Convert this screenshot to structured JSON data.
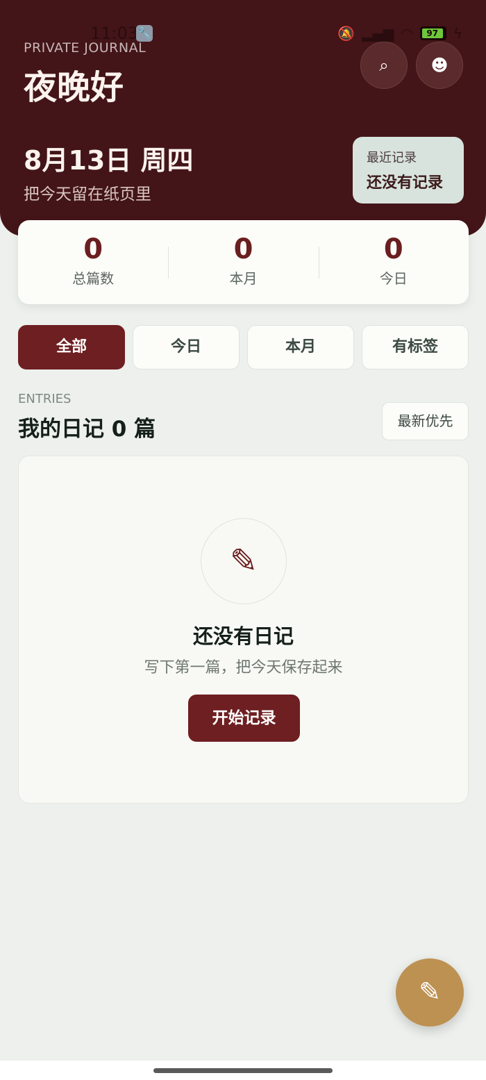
{
  "status_bar": {
    "time": "11:03",
    "battery": "97"
  },
  "header": {
    "eyebrow": "PRIVATE JOURNAL",
    "greeting": "夜晚好",
    "date": "8月13日 周四",
    "subtitle": "把今天留在纸页里",
    "search_icon": "⌕",
    "profile_icon": "☻"
  },
  "recent": {
    "label": "最近记录",
    "value": "还没有记录"
  },
  "stats": [
    {
      "value": "0",
      "label": "总篇数"
    },
    {
      "value": "0",
      "label": "本月"
    },
    {
      "value": "0",
      "label": "今日"
    }
  ],
  "filters": [
    {
      "label": "全部",
      "active": true
    },
    {
      "label": "今日"
    },
    {
      "label": "本月"
    },
    {
      "label": "有标签"
    }
  ],
  "entries": {
    "eyebrow": "ENTRIES",
    "title": "我的日记 0 篇",
    "sort_label": "最新优先"
  },
  "empty_state": {
    "icon": "✎",
    "title": "还没有日记",
    "subtitle": "写下第一篇，把今天保存起来",
    "button_label": "开始记录"
  },
  "fab": {
    "icon": "✎"
  },
  "colors": {
    "header_bg": "#431518",
    "accent": "#6e1f21",
    "fab": "#bd9152",
    "page_bg": "#edf0ec"
  }
}
